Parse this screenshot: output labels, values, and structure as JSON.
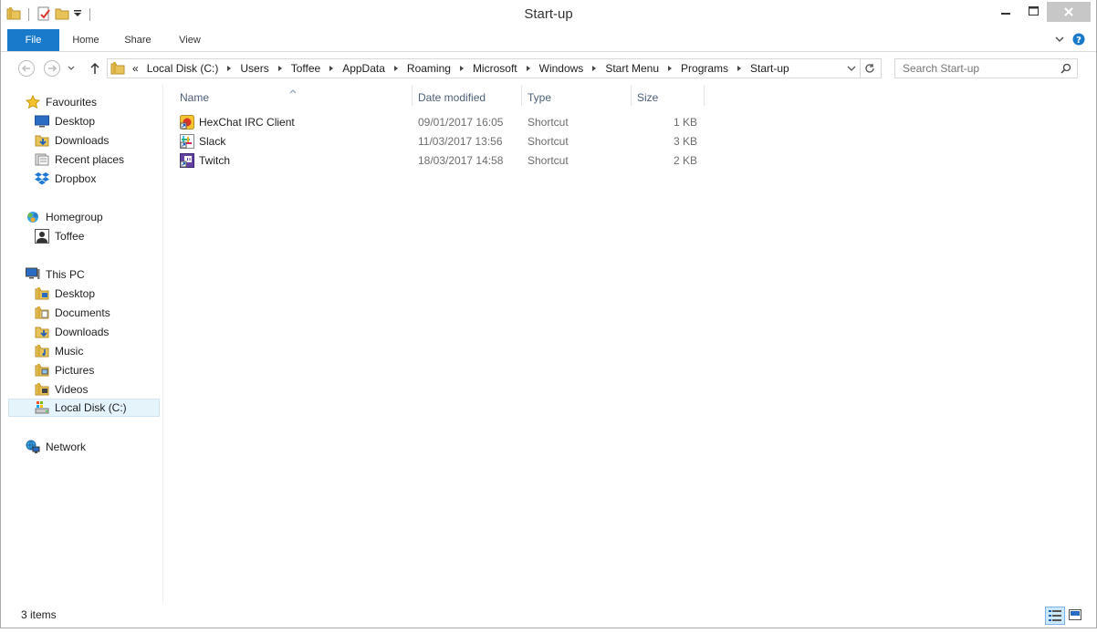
{
  "window": {
    "title": "Start-up"
  },
  "ribbon": {
    "file": "File",
    "home": "Home",
    "share": "Share",
    "view": "View"
  },
  "address": {
    "overflow": "«",
    "crumbs": [
      "Local Disk (C:)",
      "Users",
      "Toffee",
      "AppData",
      "Roaming",
      "Microsoft",
      "Windows",
      "Start Menu",
      "Programs",
      "Start-up"
    ]
  },
  "search": {
    "placeholder": "Search Start-up"
  },
  "nav": {
    "favourites": {
      "label": "Favourites",
      "items": [
        "Desktop",
        "Downloads",
        "Recent places",
        "Dropbox"
      ]
    },
    "homegroup": {
      "label": "Homegroup",
      "items": [
        "Toffee"
      ]
    },
    "thispc": {
      "label": "This PC",
      "items": [
        "Desktop",
        "Documents",
        "Downloads",
        "Music",
        "Pictures",
        "Videos",
        "Local Disk (C:)"
      ]
    },
    "network": {
      "label": "Network"
    }
  },
  "columns": {
    "name": "Name",
    "date": "Date modified",
    "type": "Type",
    "size": "Size"
  },
  "files": [
    {
      "name": "HexChat IRC Client",
      "date": "09/01/2017 16:05",
      "type": "Shortcut",
      "size": "1 KB"
    },
    {
      "name": "Slack",
      "date": "11/03/2017 13:56",
      "type": "Shortcut",
      "size": "3 KB"
    },
    {
      "name": "Twitch",
      "date": "18/03/2017 14:58",
      "type": "Shortcut",
      "size": "2 KB"
    }
  ],
  "status": {
    "items": "3 items"
  },
  "colors": {
    "file_tab": "#1979ca",
    "selected_bg": "#e5f3fb",
    "header_text": "#4c607a"
  }
}
